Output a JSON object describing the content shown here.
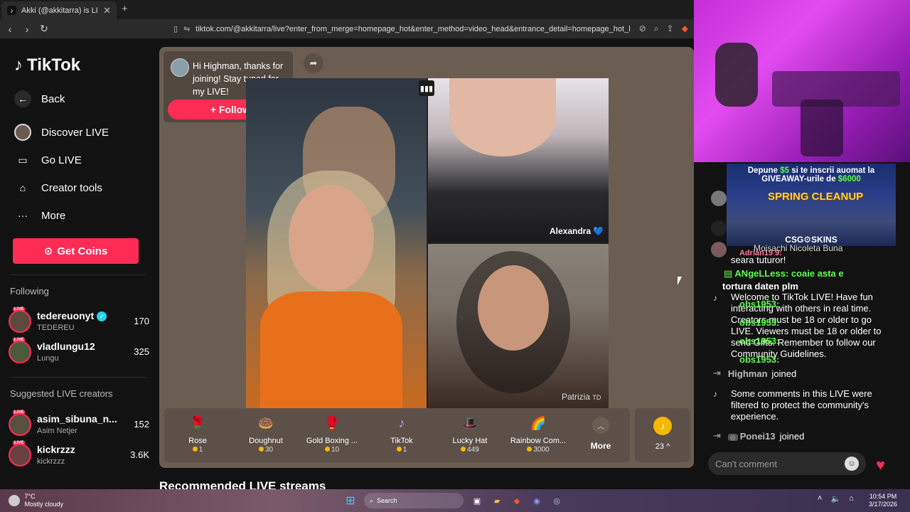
{
  "browser": {
    "tab_title": "Akki (@akkitarra) is LIVE - TikTok",
    "url": "tiktok.com/@akkitarra/live?enter_from_merge=homepage_hot&enter_method=video_head&entrance_detail=homepage_hot_live_head&fr..."
  },
  "sidebar": {
    "logo": "TikTok",
    "back": "Back",
    "nav": [
      {
        "label": "Discover LIVE",
        "icon": "avatar-icon"
      },
      {
        "label": "Go LIVE",
        "icon": "camera-icon"
      },
      {
        "label": "Creator tools",
        "icon": "creator-tools-icon"
      },
      {
        "label": "More",
        "icon": "more-icon"
      }
    ],
    "get_coins": "Get Coins",
    "following_title": "Following",
    "following": [
      {
        "name": "tedereuonyt",
        "sub": "TEDEREU",
        "count": "170",
        "verified": true
      },
      {
        "name": "vladlungu12",
        "sub": "Lungu",
        "count": "325",
        "verified": false
      }
    ],
    "suggested_title": "Suggested LIVE creators",
    "suggested": [
      {
        "name": "asim_sibuna_n...",
        "sub": "Asim Netjer",
        "count": "152"
      },
      {
        "name": "kickrzzz",
        "sub": "kickrzzz",
        "count": "3.6K"
      }
    ],
    "live_badge": "LIVE"
  },
  "live": {
    "welcome_msg": "Hi Highman, thanks for joining! Stay tuned for my LIVE!",
    "follow_label": "+ Follow",
    "guests": [
      {
        "name": "Alexandra 💙"
      },
      {
        "name": "Patrizia",
        "suffix": "TD"
      }
    ]
  },
  "gifts": [
    {
      "name": "Rose",
      "price": "1",
      "icon": "🌹"
    },
    {
      "name": "Doughnut",
      "price": "30",
      "icon": "🍩"
    },
    {
      "name": "Gold Boxing ...",
      "price": "10",
      "icon": "🥊"
    },
    {
      "name": "TikTok",
      "price": "1",
      "icon": "♪"
    },
    {
      "name": "Lucky Hat",
      "price": "449",
      "icon": "🎩"
    },
    {
      "name": "Rainbow Com...",
      "price": "3000",
      "icon": "🌈"
    }
  ],
  "gift_more": "More",
  "coin_balance": "23",
  "recommended_title": "Recommended LIVE streams",
  "chat": {
    "banner": {
      "line1_pre": "Depune ",
      "line1_amt": "$5",
      "line1_post": " si te inscrii auomat la",
      "line2_pre": "GIVEAWAY-urile de ",
      "line2_amt": "$6000",
      "spring": "SPRING CLEANUP",
      "brand": "CSG⚙SKINS"
    },
    "lines": [
      {
        "text": "Adrian19 9:",
        "style": "green"
      },
      {
        "text": "Moisachi Nicoleta  Buna",
        "style": "plain"
      },
      {
        "text": "seara tuturor!",
        "style": "plain"
      },
      {
        "text": "ANgeLLess: coaie asta e",
        "style": "green"
      },
      {
        "text": "tortura daten plm",
        "style": "bold"
      },
      {
        "text": "obs1953:",
        "style": "green"
      },
      {
        "text": "obs1953:",
        "style": "green"
      },
      {
        "text": "obs1953:",
        "style": "green"
      },
      {
        "text": "obs1953:",
        "style": "green"
      }
    ],
    "welcome": "Welcome to TikTok LIVE! Have fun interacting with others in real time. Creators must be 18 or older to go LIVE. Viewers must be 18 or older to send Gifts. Remember to follow our Community Guidelines.",
    "joined1_user": "Highman",
    "joined_word": "joined",
    "filtered": "Some comments in this LIVE were filtered to protect the community's experience.",
    "joined2_user": "Ponei13",
    "comment_placeholder": "Can't comment"
  },
  "taskbar": {
    "temp": "7°C",
    "weather": "Mostly cloudy",
    "search": "Search",
    "time": "10:54 PM",
    "date": "3/17/2026"
  }
}
